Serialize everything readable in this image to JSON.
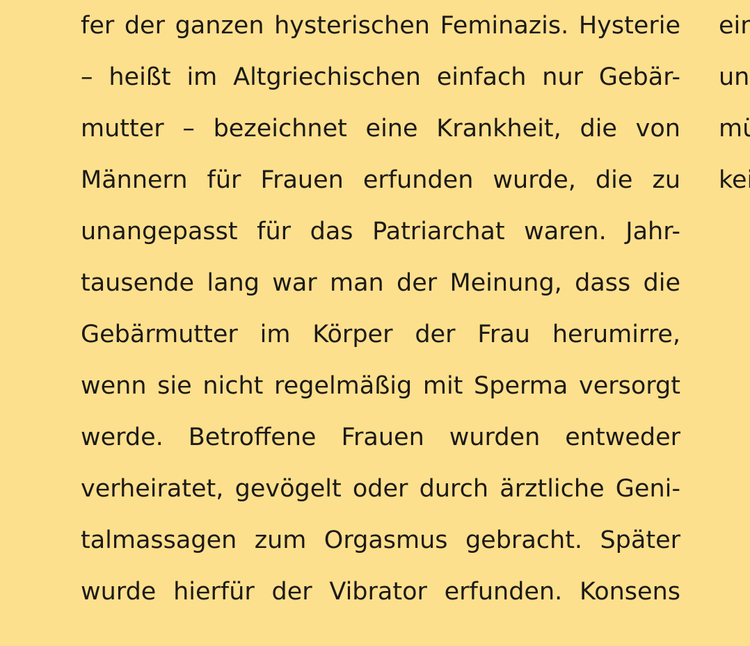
{
  "colors": {
    "background": "#fde08d",
    "text": "#1c1a17"
  },
  "main_column": {
    "lines": [
      "fer der ganzen hysterischen Feminazis. Hysterie",
      "– heißt im Altgriechischen einfach nur Gebär-",
      "mutter – bezeichnet eine Krankheit, die von",
      "Männern für Frauen erfunden wurde, die zu",
      "unangepasst für das Patriarchat waren. Jahr-",
      "tausende lang war man der Meinung, dass die",
      "Gebärmutter im Körper der Frau herumirre,",
      "wenn sie nicht regelmäßig mit Sperma versorgt",
      "werde. Betroffene Frauen wurden entweder",
      "verheiratet, gevögelt oder durch ärztliche Geni-",
      "talmassagen zum Orgasmus gebracht. Später",
      "wurde hierfür der Vibrator erfunden. Konsens"
    ]
  },
  "side_column": {
    "lines": [
      "ein",
      "un",
      "mü",
      "kei"
    ]
  }
}
